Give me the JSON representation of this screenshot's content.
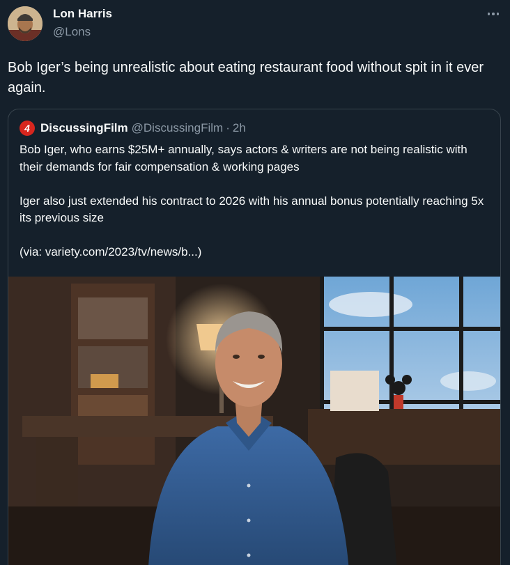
{
  "author": {
    "name": "Lon Harris",
    "handle": "@Lons"
  },
  "tweet": {
    "text": "Bob Iger’s being unrealistic about eating restaurant food without spit in it ever again."
  },
  "quoted": {
    "logo_glyph": "4",
    "name": "DiscussingFilm",
    "handle": "@DiscussingFilm",
    "separator": "·",
    "time": "2h",
    "text": "Bob Iger, who earns $25M+ annually, says actors & writers are not being realistic with their demands for fair compensation & working pages\n\nIger also just extended his contract to 2026 with his annual bonus potentially reaching 5x its previous size\n\n(via: variety.com/2023/tv/news/b...)"
  },
  "icons": {
    "more": "more-horizontal-icon"
  },
  "colors": {
    "background": "#15202b",
    "text": "#f7f9f9",
    "secondary_text": "#8b98a5",
    "border": "#38444d",
    "brand_red": "#d7261e"
  }
}
